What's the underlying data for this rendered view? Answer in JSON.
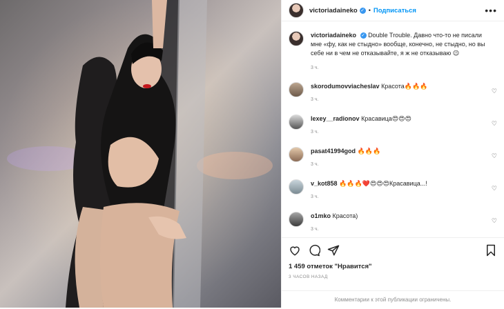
{
  "header": {
    "username": "victoriadaineko",
    "verified_mark": "✓",
    "separator": "•",
    "follow_label": "Подписаться",
    "more_label": "•••"
  },
  "caption": {
    "username": "victoriadaineko",
    "text": "Double Trouble. Давно что-то не писали мне «фу, как не стыдно» вообще, конечно, не стыдно, но вы себе ни в чем не отказывайте, я ж не отказываю 😉",
    "time": "3 ч."
  },
  "comments": [
    {
      "username": "skorodumovviacheslav",
      "text": "Красота🔥🔥🔥",
      "time": "3 ч."
    },
    {
      "username": "lexey__radionov",
      "text": "Красавица😍😍😍",
      "time": "3 ч."
    },
    {
      "username": "pasat41994god",
      "text": "🔥🔥🔥",
      "time": "3 ч."
    },
    {
      "username": "v_kot858",
      "text": "🔥🔥🔥❤️😍😍😍Красавица...!",
      "time": "3 ч."
    },
    {
      "username": "o1mko",
      "text": "Красота)",
      "time": "3 ч."
    }
  ],
  "comment_like_icon": "heart-outline-icon",
  "actions": {
    "like_icon": "heart-outline-icon",
    "comment_icon": "comment-bubble-icon",
    "share_icon": "paper-plane-icon",
    "save_icon": "bookmark-icon"
  },
  "likes_text": "1 459 отметок \"Нравится\"",
  "posted_time": "3 ЧАСОВ НАЗАД",
  "comments_limited": "Комментарии к этой публикации ограничены."
}
